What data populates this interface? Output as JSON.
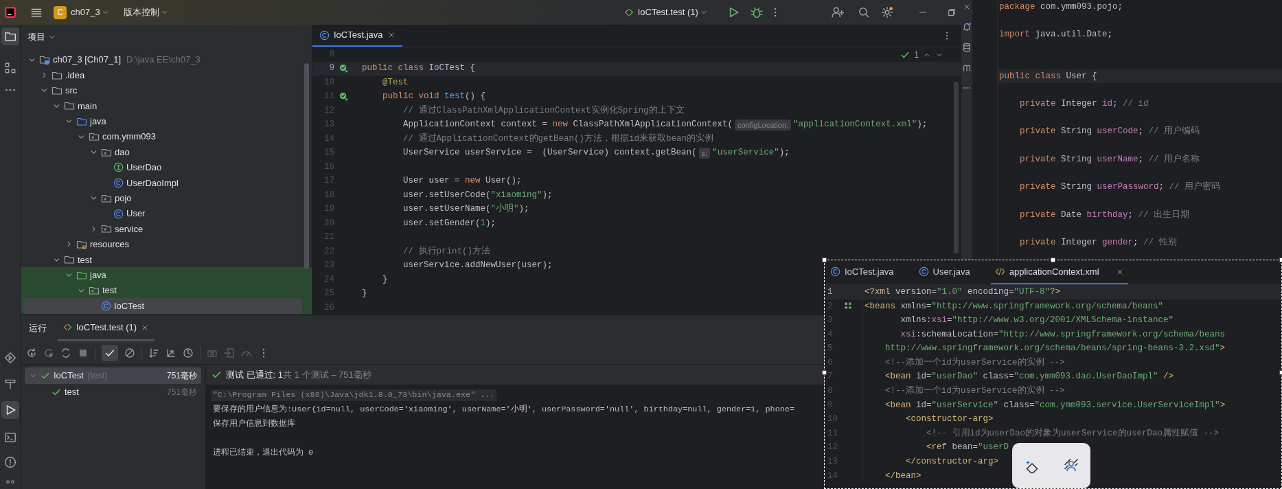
{
  "title_bar": {
    "project_badge": "C",
    "project": "ch07_3",
    "vcs": "版本控制",
    "run_config": "IoCTest.test (1)"
  },
  "project_panel": {
    "title": "项目",
    "tree": [
      {
        "label": "ch07_3 [Ch07_1]",
        "detail": "D:\\java EE\\ch07_3",
        "kind": "module",
        "expanded": true,
        "selected": false,
        "highlighted": false,
        "children": [
          {
            "label": ".idea",
            "kind": "folder",
            "expanded": false,
            "selected": false,
            "highlighted": false
          },
          {
            "label": "src",
            "kind": "folder",
            "expanded": true,
            "selected": false,
            "highlighted": false,
            "children": [
              {
                "label": "main",
                "kind": "folder",
                "expanded": true,
                "selected": false,
                "highlighted": false,
                "children": [
                  {
                    "label": "java",
                    "kind": "source-folder",
                    "expanded": true,
                    "selected": false,
                    "highlighted": false,
                    "children": [
                      {
                        "label": "com.ymm093",
                        "kind": "package",
                        "expanded": true,
                        "selected": false,
                        "highlighted": false,
                        "children": [
                          {
                            "label": "dao",
                            "kind": "package",
                            "expanded": true,
                            "selected": false,
                            "highlighted": false,
                            "children": [
                              {
                                "label": "UserDao",
                                "kind": "interface",
                                "selected": false,
                                "highlighted": false
                              },
                              {
                                "label": "UserDaoImpl",
                                "kind": "class",
                                "selected": false,
                                "highlighted": false
                              }
                            ]
                          },
                          {
                            "label": "pojo",
                            "kind": "package",
                            "expanded": true,
                            "selected": false,
                            "highlighted": false,
                            "children": [
                              {
                                "label": "User",
                                "kind": "class",
                                "selected": false,
                                "highlighted": false
                              }
                            ]
                          },
                          {
                            "label": "service",
                            "kind": "package",
                            "expanded": false,
                            "selected": false,
                            "highlighted": false
                          }
                        ]
                      }
                    ]
                  },
                  {
                    "label": "resources",
                    "kind": "resources",
                    "expanded": false,
                    "selected": false,
                    "highlighted": false
                  }
                ]
              },
              {
                "label": "test",
                "kind": "folder",
                "expanded": true,
                "selected": false,
                "highlighted": false,
                "children": [
                  {
                    "label": "java",
                    "kind": "test-folder",
                    "expanded": true,
                    "selected": false,
                    "highlighted": true,
                    "children": [
                      {
                        "label": "test",
                        "kind": "package",
                        "expanded": true,
                        "selected": false,
                        "highlighted": true,
                        "children": [
                          {
                            "label": "IoCTest",
                            "kind": "class",
                            "selected": true,
                            "highlighted": true
                          }
                        ]
                      }
                    ]
                  }
                ]
              }
            ]
          }
        ]
      }
    ]
  },
  "editor": {
    "tabs": [
      {
        "label": "IoCTest.java",
        "selected": true
      }
    ],
    "inspection": "1",
    "lines": [
      {
        "number": "8",
        "kind": "plain",
        "current": false
      },
      {
        "number": "9",
        "kind": "runnable",
        "current": true,
        "segments": [
          {
            "kind": "keyword",
            "text": "public class "
          },
          {
            "kind": "plain",
            "text": "IoCTest {"
          }
        ]
      },
      {
        "number": "10",
        "kind": "plain",
        "current": false,
        "segments": [
          {
            "kind": "annotation",
            "text": "    @Test"
          }
        ]
      },
      {
        "number": "11",
        "kind": "runnable",
        "current": false,
        "segments": [
          {
            "kind": "keyword",
            "text": "    public void "
          },
          {
            "kind": "method",
            "text": "test"
          },
          {
            "kind": "plain",
            "text": "() {"
          }
        ]
      },
      {
        "number": "12",
        "kind": "plain",
        "current": false,
        "segments": [
          {
            "kind": "comment",
            "text": "        // 通过ClassPathXmlApplicationContext实例化Spring的上下文"
          }
        ]
      },
      {
        "number": "13",
        "kind": "plain",
        "current": false,
        "segments": [
          {
            "kind": "plain",
            "text": "        ApplicationContext context = "
          },
          {
            "kind": "keyword",
            "text": "new "
          },
          {
            "kind": "plain",
            "text": "ClassPathXmlApplicationContext("
          },
          {
            "kind": "hint",
            "text": "configLocation:"
          },
          {
            "kind": "string",
            "text": "\"applicationContext.xml\""
          },
          {
            "kind": "plain",
            "text": ");"
          }
        ]
      },
      {
        "number": "14",
        "kind": "plain",
        "current": false,
        "segments": [
          {
            "kind": "comment",
            "text": "        // 通过ApplicationContext的getBean()方法，根据id来获取bean的实例"
          }
        ]
      },
      {
        "number": "15",
        "kind": "plain",
        "current": false,
        "segments": [
          {
            "kind": "plain",
            "text": "        UserService userService =  (UserService) context.getBean("
          },
          {
            "kind": "hint",
            "text": "s:"
          },
          {
            "kind": "string",
            "text": "\"userService\""
          },
          {
            "kind": "plain",
            "text": ");"
          }
        ]
      },
      {
        "number": "16",
        "kind": "plain",
        "current": false
      },
      {
        "number": "17",
        "kind": "plain",
        "current": false,
        "segments": [
          {
            "kind": "plain",
            "text": "        User user = "
          },
          {
            "kind": "keyword",
            "text": "new "
          },
          {
            "kind": "plain",
            "text": "User();"
          }
        ]
      },
      {
        "number": "18",
        "kind": "plain",
        "current": false,
        "segments": [
          {
            "kind": "plain",
            "text": "        user.setUserCode("
          },
          {
            "kind": "string",
            "text": "\"xiaoming\""
          },
          {
            "kind": "plain",
            "text": ");"
          }
        ]
      },
      {
        "number": "19",
        "kind": "plain",
        "current": false,
        "segments": [
          {
            "kind": "plain",
            "text": "        user.setUserName("
          },
          {
            "kind": "string",
            "text": "\"小明\""
          },
          {
            "kind": "plain",
            "text": ");"
          }
        ]
      },
      {
        "number": "20",
        "kind": "plain",
        "current": false,
        "segments": [
          {
            "kind": "plain",
            "text": "        user.setGender("
          },
          {
            "kind": "number",
            "text": "1"
          },
          {
            "kind": "plain",
            "text": ");"
          }
        ]
      },
      {
        "number": "21",
        "kind": "plain",
        "current": false
      },
      {
        "number": "22",
        "kind": "plain",
        "current": false,
        "segments": [
          {
            "kind": "comment",
            "text": "        // 执行print()方法"
          }
        ]
      },
      {
        "number": "23",
        "kind": "plain",
        "current": false,
        "segments": [
          {
            "kind": "plain",
            "text": "        userService.addNewUser(user);"
          }
        ]
      },
      {
        "number": "24",
        "kind": "plain",
        "current": false,
        "segments": [
          {
            "kind": "plain",
            "text": "    }"
          }
        ]
      },
      {
        "number": "25",
        "kind": "plain",
        "current": false,
        "segments": [
          {
            "kind": "plain",
            "text": "}"
          }
        ]
      },
      {
        "number": "26",
        "kind": "plain",
        "current": false
      }
    ]
  },
  "run_panel": {
    "title": "运行",
    "tabs": [
      {
        "label": "IoCTest.test (1)",
        "selected": true
      }
    ],
    "show_passed": true,
    "tests": [
      {
        "name": "IoCTest",
        "detail": "(test)",
        "time": "751毫秒",
        "passed": true,
        "selected": true,
        "expanded": true,
        "children": [
          {
            "name": "test",
            "time": "751毫秒",
            "passed": true,
            "selected": false
          }
        ]
      }
    ],
    "summary": {
      "status": "测试 已通过: 1",
      "detail": "共 1 个测试 – 751毫秒"
    },
    "output": [
      {
        "kind": "command",
        "text": "\"C:\\Program Files (x86)\\Java\\jdk1.8.0_73\\bin\\java.exe\" ..."
      },
      {
        "kind": "stdout",
        "text": "要保存的用户信息为:User{id=null, userCode='xiaoming', userName='小明', userPassword='null', birthday=null, gender=1, phone="
      },
      {
        "kind": "stdout",
        "text": "保存用户信息到数据库"
      },
      {
        "kind": "exit",
        "text": "进程已结束，退出代码为 0"
      }
    ]
  },
  "user_file": {
    "lines": [
      {
        "current": false,
        "segments": [
          {
            "kind": "keyword",
            "text": "package "
          },
          {
            "kind": "plain",
            "text": "com.ymm093.pojo;"
          }
        ]
      },
      {
        "current": false
      },
      {
        "current": false,
        "segments": [
          {
            "kind": "keyword",
            "text": "import "
          },
          {
            "kind": "plain",
            "text": "java.util.Date;"
          }
        ]
      },
      {
        "current": false
      },
      {
        "current": false
      },
      {
        "current": true,
        "segments": [
          {
            "kind": "keyword",
            "text": "public class "
          },
          {
            "kind": "plain",
            "text": "User {"
          }
        ]
      },
      {
        "current": false
      },
      {
        "current": false,
        "segments": [
          {
            "kind": "keyword",
            "text": "    private "
          },
          {
            "kind": "plain",
            "text": "Integer "
          },
          {
            "kind": "field",
            "text": "id"
          },
          {
            "kind": "plain",
            "text": "; "
          },
          {
            "kind": "comment",
            "text": "// id"
          }
        ]
      },
      {
        "current": false
      },
      {
        "current": false,
        "segments": [
          {
            "kind": "keyword",
            "text": "    private "
          },
          {
            "kind": "plain",
            "text": "String "
          },
          {
            "kind": "field",
            "text": "userCode"
          },
          {
            "kind": "plain",
            "text": "; "
          },
          {
            "kind": "comment",
            "text": "// 用户编码"
          }
        ]
      },
      {
        "current": false
      },
      {
        "current": false,
        "segments": [
          {
            "kind": "keyword",
            "text": "    private "
          },
          {
            "kind": "plain",
            "text": "String "
          },
          {
            "kind": "field",
            "text": "userName"
          },
          {
            "kind": "plain",
            "text": "; "
          },
          {
            "kind": "comment",
            "text": "// 用户名称"
          }
        ]
      },
      {
        "current": false
      },
      {
        "current": false,
        "segments": [
          {
            "kind": "keyword",
            "text": "    private "
          },
          {
            "kind": "plain",
            "text": "String "
          },
          {
            "kind": "field",
            "text": "userPassword"
          },
          {
            "kind": "plain",
            "text": "; "
          },
          {
            "kind": "comment",
            "text": "// 用户密码"
          }
        ]
      },
      {
        "current": false
      },
      {
        "current": false,
        "segments": [
          {
            "kind": "keyword",
            "text": "    private "
          },
          {
            "kind": "plain",
            "text": "Date "
          },
          {
            "kind": "field",
            "text": "birthday"
          },
          {
            "kind": "plain",
            "text": "; "
          },
          {
            "kind": "comment",
            "text": "// 出生日期"
          }
        ]
      },
      {
        "current": false
      },
      {
        "current": false,
        "segments": [
          {
            "kind": "keyword",
            "text": "    private "
          },
          {
            "kind": "plain",
            "text": "Integer "
          },
          {
            "kind": "field",
            "text": "gender"
          },
          {
            "kind": "plain",
            "text": "; "
          },
          {
            "kind": "comment",
            "text": "// 性别"
          }
        ]
      }
    ]
  },
  "xml_file": {
    "tabs": [
      {
        "label": "IoCTest.java",
        "kind": "class",
        "selected": false
      },
      {
        "label": "User.java",
        "kind": "class",
        "selected": false
      },
      {
        "label": "applicationContext.xml",
        "kind": "xml",
        "selected": true
      }
    ],
    "lines": [
      {
        "number": "1",
        "kind": "plain",
        "current": true,
        "segments": [
          {
            "kind": "tag",
            "text": "<?xml "
          },
          {
            "kind": "attr",
            "text": "version="
          },
          {
            "kind": "string",
            "text": "\"1.0\" "
          },
          {
            "kind": "attr",
            "text": "encoding="
          },
          {
            "kind": "string",
            "text": "\"UTF-8\""
          },
          {
            "kind": "tag",
            "text": "?>"
          }
        ]
      },
      {
        "number": "2",
        "kind": "bean",
        "current": false,
        "segments": [
          {
            "kind": "tag",
            "text": "<beans "
          },
          {
            "kind": "attr",
            "text": "xmlns="
          },
          {
            "kind": "string",
            "text": "\"http://www.springframework.org/schema/beans\""
          }
        ]
      },
      {
        "number": "3",
        "kind": "plain",
        "current": false,
        "segments": [
          {
            "kind": "attr",
            "text": "       xmlns:"
          },
          {
            "kind": "ns",
            "text": "xsi"
          },
          {
            "kind": "attr",
            "text": "="
          },
          {
            "kind": "string",
            "text": "\"http://www.w3.org/2001/XMLSchema-instance\""
          }
        ]
      },
      {
        "number": "4",
        "kind": "plain",
        "current": false,
        "segments": [
          {
            "kind": "ns",
            "text": "       xsi"
          },
          {
            "kind": "attr",
            "text": ":schemaLocation="
          },
          {
            "kind": "string",
            "text": "\"http://www.springframework.org/schema/beans"
          }
        ]
      },
      {
        "number": "5",
        "kind": "plain",
        "current": false,
        "segments": [
          {
            "kind": "string",
            "text": "    http://www.springframework.org/schema/beans/spring-beans-3.2.xsd\""
          },
          {
            "kind": "tag",
            "text": ">"
          }
        ]
      },
      {
        "number": "6",
        "kind": "plain",
        "current": false,
        "segments": [
          {
            "kind": "comment",
            "text": "    <!--添加一个id为userService的实例 -->"
          }
        ]
      },
      {
        "number": "7",
        "kind": "plain",
        "current": false,
        "segments": [
          {
            "kind": "tag",
            "text": "    <bean "
          },
          {
            "kind": "attr",
            "text": "id="
          },
          {
            "kind": "string",
            "text": "\"userDao\" "
          },
          {
            "kind": "attr",
            "text": "class="
          },
          {
            "kind": "string",
            "text": "\"com.ymm093.dao.UserDaoImpl\" "
          },
          {
            "kind": "tag",
            "text": "/>"
          }
        ]
      },
      {
        "number": "8",
        "kind": "plain",
        "current": false,
        "segments": [
          {
            "kind": "comment",
            "text": "    <!--添加一个id为userService的实例 -->"
          }
        ]
      },
      {
        "number": "9",
        "kind": "plain",
        "current": false,
        "segments": [
          {
            "kind": "tag",
            "text": "    <bean "
          },
          {
            "kind": "attr",
            "text": "id="
          },
          {
            "kind": "string",
            "text": "\"userService\" "
          },
          {
            "kind": "attr",
            "text": "class="
          },
          {
            "kind": "string",
            "text": "\"com.ymm093.service.UserServiceImpl\""
          },
          {
            "kind": "tag",
            "text": ">"
          }
        ]
      },
      {
        "number": "10",
        "kind": "plain",
        "current": false,
        "segments": [
          {
            "kind": "tag",
            "text": "        <constructor-arg>"
          }
        ]
      },
      {
        "number": "11",
        "kind": "plain",
        "current": false,
        "segments": [
          {
            "kind": "comment",
            "text": "            <!-- 引用id为userDao的对象为userService的userDao属性赋值 -->"
          }
        ]
      },
      {
        "number": "12",
        "kind": "plain",
        "current": false,
        "segments": [
          {
            "kind": "tag",
            "text": "            <ref "
          },
          {
            "kind": "attr",
            "text": "bean="
          },
          {
            "kind": "string",
            "text": "\"userD"
          }
        ]
      },
      {
        "number": "13",
        "kind": "plain",
        "current": false,
        "segments": [
          {
            "kind": "tag",
            "text": "        </constructor-arg>"
          }
        ]
      },
      {
        "number": "14",
        "kind": "plain",
        "current": false,
        "segments": [
          {
            "kind": "tag",
            "text": "    </bean>"
          }
        ]
      }
    ]
  }
}
